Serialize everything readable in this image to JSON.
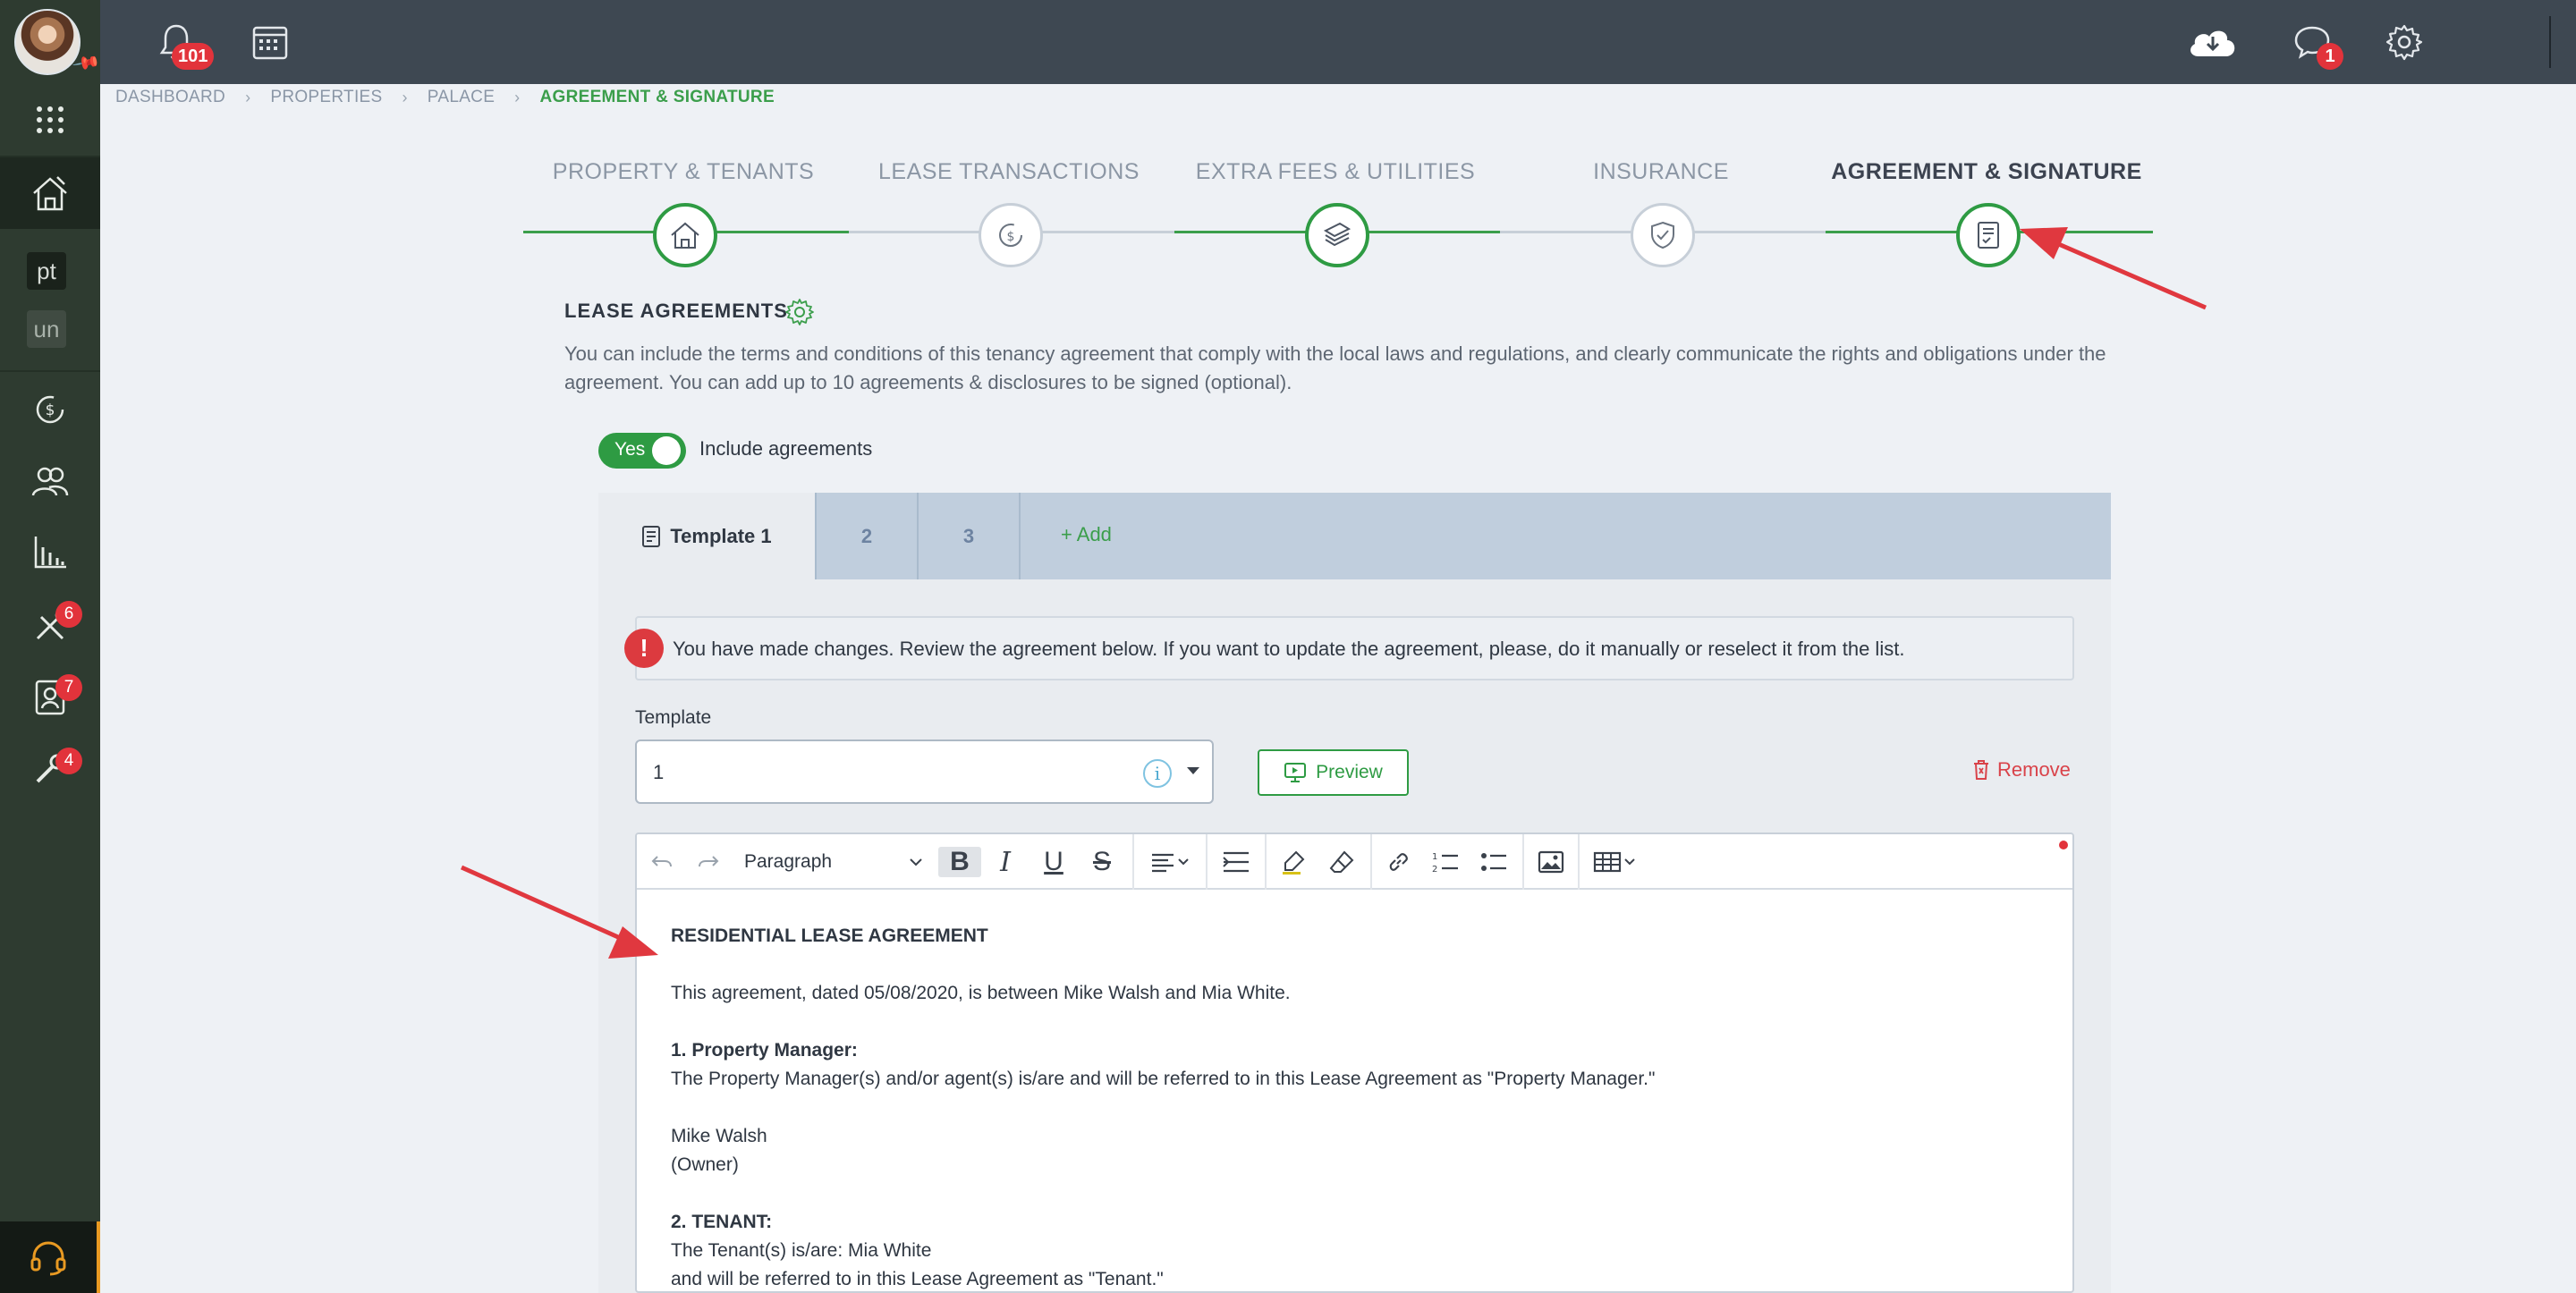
{
  "topbar": {
    "notifications_count": "101",
    "messages_count": "1"
  },
  "sidebar": {
    "tag1": "pt",
    "tag2": "un",
    "badges": {
      "maintenance": "6",
      "applications": "7",
      "tools": "4"
    }
  },
  "breadcrumb": {
    "items": [
      "DASHBOARD",
      "PROPERTIES",
      "PALACE"
    ],
    "current": "AGREEMENT & SIGNATURE"
  },
  "steps": [
    {
      "label": "PROPERTY & TENANTS",
      "state": "done"
    },
    {
      "label": "LEASE TRANSACTIONS",
      "state": "pending"
    },
    {
      "label": "EXTRA FEES & UTILITIES",
      "state": "done"
    },
    {
      "label": "INSURANCE",
      "state": "pending"
    },
    {
      "label": "AGREEMENT & SIGNATURE",
      "state": "active"
    }
  ],
  "section": {
    "title": "LEASE AGREEMENTS",
    "description": "You can include the terms and conditions of this tenancy agreement that comply with the local laws and regulations, and clearly communicate the rights and obligations under the agreement. You can add up to 10 agreements & disclosures to be signed (optional).",
    "toggle_value": "Yes",
    "toggle_label": "Include agreements"
  },
  "tabs": {
    "items": [
      "Template 1",
      "2",
      "3"
    ],
    "add_label": "Add"
  },
  "alert": {
    "message": "You have made changes. Review the agreement below. If you want to update the agreement, please, do it manually or reselect it from the list."
  },
  "template": {
    "label": "Template",
    "value": "1",
    "info": "i",
    "preview_label": "Preview",
    "remove_label": "Remove"
  },
  "editor": {
    "block_format": "Paragraph",
    "title": "RESIDENTIAL LEASE AGREEMENT",
    "intro": "This agreement, dated 05/08/2020, is between Mike Walsh and Mia White.",
    "pm_heading": "1. Property Manager:",
    "pm_text": "The Property Manager(s) and/or agent(s) is/are and will be referred to in this Lease Agreement as \"Property Manager.\"",
    "owner_name": "Mike Walsh",
    "owner_role": "(Owner)",
    "tenant_heading": "2. TENANT:",
    "tenant_line1": "The Tenant(s) is/are: Mia White",
    "tenant_line2": "and will be referred to in this Lease Agreement as \"Tenant.\""
  },
  "colors": {
    "topbar": "#3e4852",
    "sidebar": "#2e3b30",
    "accent_green": "#2e9b43",
    "danger": "#e2333b",
    "tab_bar": "#c0cedd"
  }
}
